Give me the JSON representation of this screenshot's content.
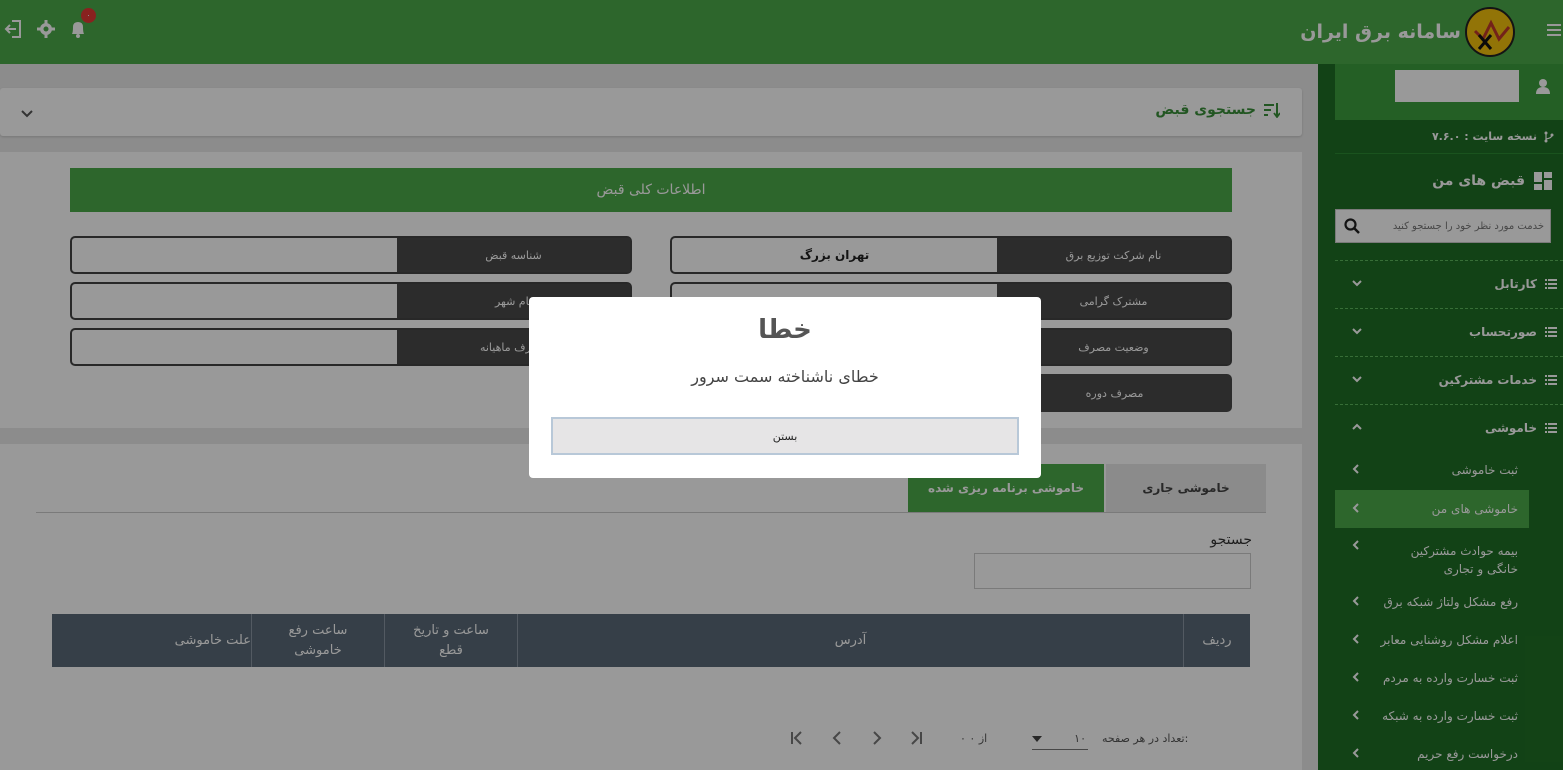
{
  "app": {
    "title": "سامانه برق ایران",
    "notif_count": "۰"
  },
  "sidebar": {
    "version": "نسخه سایت : ۷.۶.۰",
    "my_bills": "قبض های من",
    "search_placeholder": "خدمت مورد نظر خود را جستجو کنید",
    "items": [
      {
        "label": "کارتابل"
      },
      {
        "label": "صورتحساب"
      },
      {
        "label": "خدمات مشترکین"
      },
      {
        "label": "خاموشی"
      }
    ],
    "sub_items": [
      {
        "label": "ثبت خاموشی"
      },
      {
        "label": "خاموشی های من"
      },
      {
        "label": "بیمه حوادث مشترکین خانگی و تجاری"
      },
      {
        "label": "رفع مشکل ولتاژ شبکه برق"
      },
      {
        "label": "اعلام مشکل روشنایی معابر"
      },
      {
        "label": "ثبت خسارت وارده به مردم"
      },
      {
        "label": "ثبت خسارت وارده به شبکه"
      },
      {
        "label": "درخواست رفع حریم"
      }
    ]
  },
  "search_panel": {
    "title": "جستجوی قبض"
  },
  "info": {
    "header": "اطلاعات کلی قبض",
    "fields": {
      "company_label": "نام شرکت توزیع برق",
      "company_value": "تهران بزرگ",
      "bill_id_label": "شناسه قبض",
      "subscriber_label": "مشترک گرامی",
      "city_label": "نام شهر",
      "consumption_status_label": "وضعیت مصرف",
      "monthly_label": "مصرف ماهیانه",
      "period_label": "مصرف دوره"
    }
  },
  "outage": {
    "tab_current": "خاموشی جاری",
    "tab_scheduled": "خاموشی برنامه ریزی شده",
    "search_label": "جستجو",
    "columns": [
      "ردیف",
      "آدرس",
      "ساعت و تاریخ قطع",
      "ساعت رفع خاموشی",
      "علت خاموشی"
    ],
    "pagination": {
      "per_page_label": "تعداد در هر صفحه:",
      "per_page_value": "۱۰",
      "range": "۰ از ۰"
    }
  },
  "modal": {
    "title": "خطا",
    "message": "خطای ناشناخته سمت سرور",
    "close": "بستن"
  },
  "colors": {
    "primary": "#4caa4a",
    "sidebar": "#1f6f25",
    "label_bg": "#4a4a4a",
    "table_head": "#5a6a78"
  }
}
